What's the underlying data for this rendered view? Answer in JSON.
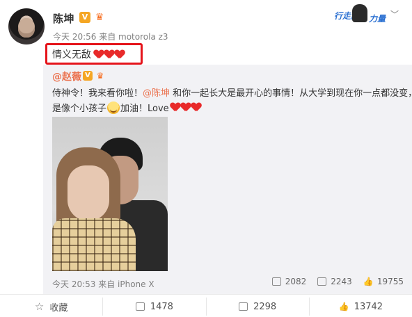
{
  "post": {
    "author": "陈坤",
    "verified_badge": "V",
    "member_icon": "crown-icon",
    "meta": "今天 20:56 来自 motorola z3",
    "text": "情义无敌",
    "heart_count": 3,
    "promo_text_left": "行走的",
    "promo_text_right": "力量",
    "chevron": "﹀",
    "accent_color": "#eb7350",
    "highlight_color": "#e5141b"
  },
  "repost": {
    "author": "@赵薇",
    "verified_badge": "V",
    "line1_pre": "侍神令！我来看你啦！",
    "line1_mention": "@陈坤",
    "line1_post": " 和你一起长大是最开心的事情！从大学到现在你一点都没变，还",
    "line2_pre": "是像个小孩子",
    "line2_post": "加油！Love",
    "meta": "今天 20:53 来自 iPhone X",
    "reposts": "2082",
    "comments": "2243",
    "likes": "19755"
  },
  "bottom_bar": {
    "favorite_label": "收藏",
    "repost_count": "1478",
    "comment_count": "2298",
    "like_count": "13742"
  }
}
